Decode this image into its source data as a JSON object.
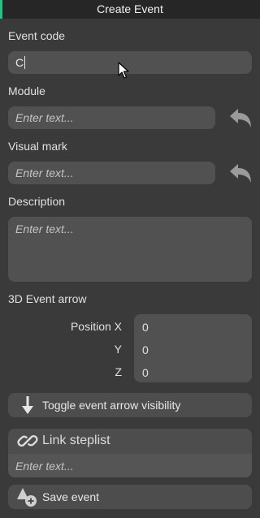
{
  "window": {
    "title": "Create Event",
    "accent_color": "#26c281"
  },
  "event_code": {
    "label": "Event code",
    "value": "C"
  },
  "module": {
    "label": "Module",
    "placeholder": "Enter text..."
  },
  "visual_mark": {
    "label": "Visual mark",
    "placeholder": "Enter text..."
  },
  "description": {
    "label": "Description",
    "placeholder": "Enter text..."
  },
  "arrow": {
    "section_label": "3D Event arrow",
    "x_label": "Position X",
    "x_value": "0",
    "y_label": "Y",
    "y_value": "0",
    "z_label": "Z",
    "z_value": "0"
  },
  "toggle_button": {
    "label": "Toggle event arrow visibility",
    "icon": "arrow-down-icon"
  },
  "link_steplist": {
    "label": "Link steplist",
    "icon": "link-icon",
    "placeholder": "Enter text..."
  },
  "save_button": {
    "label": "Save event",
    "icon": "add-event-icon"
  },
  "colors": {
    "panel": "#3a3a3a",
    "field": "#515151",
    "button": "#4d4d4d",
    "text": "#dcdcdc"
  }
}
